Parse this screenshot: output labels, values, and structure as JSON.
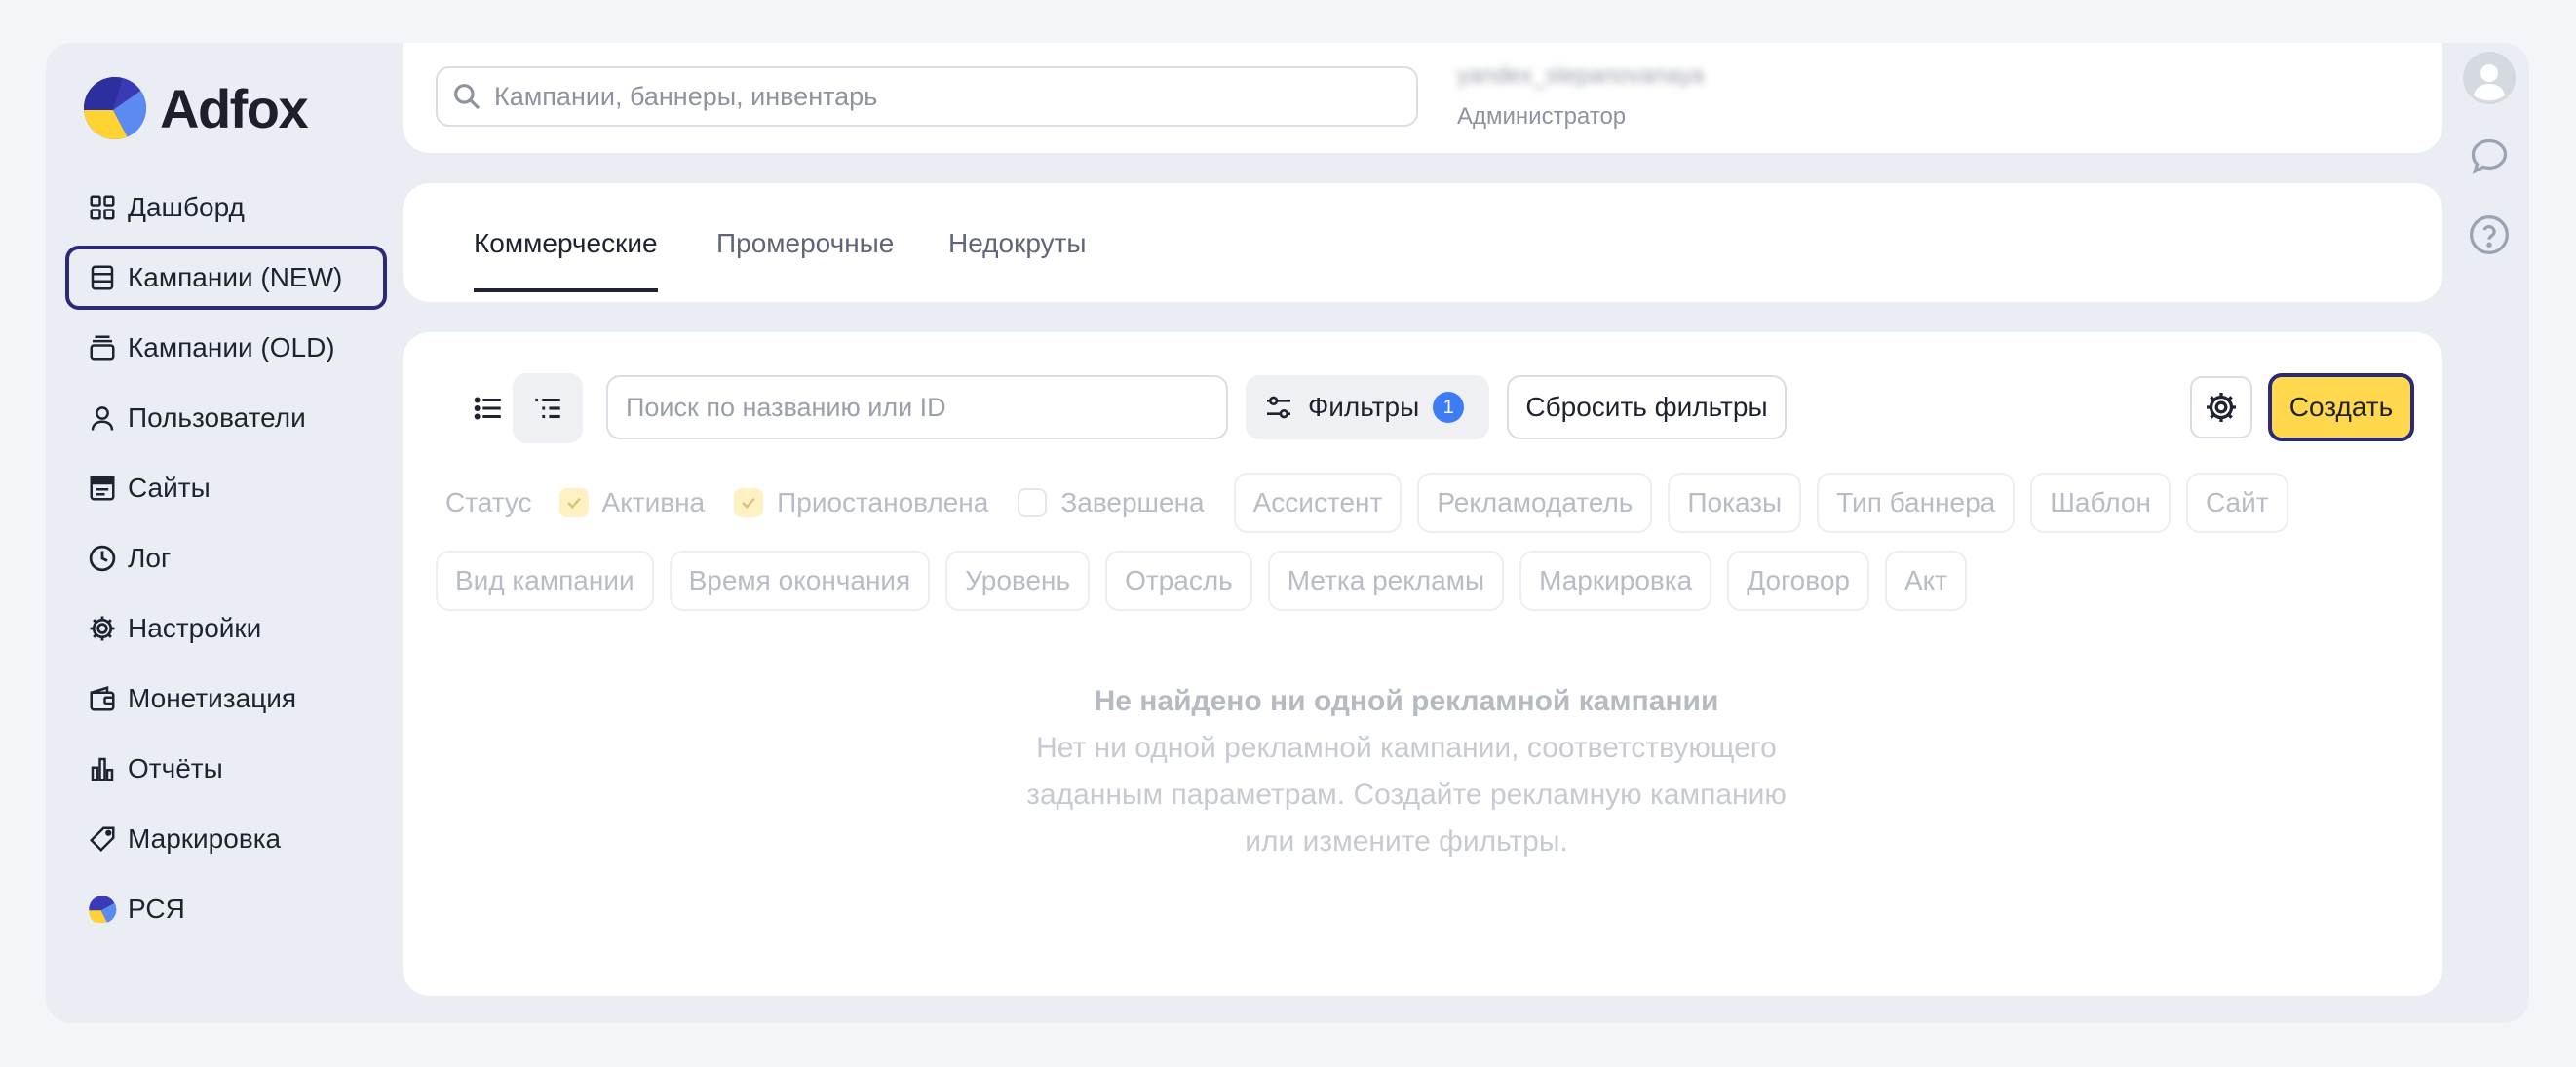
{
  "app": {
    "logo_text": "Adfox"
  },
  "sidebar": {
    "items": [
      {
        "label": "Дашборд",
        "icon": "dashboard-icon"
      },
      {
        "label": "Кампании (NEW)",
        "icon": "campaigns-new-icon",
        "active": true
      },
      {
        "label": "Кампании (OLD)",
        "icon": "campaigns-old-icon"
      },
      {
        "label": "Пользователи",
        "icon": "user-icon"
      },
      {
        "label": "Сайты",
        "icon": "sites-icon"
      },
      {
        "label": "Лог",
        "icon": "clock-icon"
      },
      {
        "label": "Настройки",
        "icon": "gear-icon"
      },
      {
        "label": "Монетизация",
        "icon": "wallet-icon"
      },
      {
        "label": "Отчёты",
        "icon": "bar-chart-icon"
      },
      {
        "label": "Маркировка",
        "icon": "tag-icon"
      },
      {
        "label": "РСЯ",
        "icon": "rsya-logo-icon"
      }
    ]
  },
  "header": {
    "search_placeholder": "Кампании, баннеры, инвентарь",
    "user_name": "yandex_stepanovanaya",
    "user_role": "Администратор"
  },
  "tabs": [
    {
      "label": "Коммерческие",
      "active": true
    },
    {
      "label": "Промерочные"
    },
    {
      "label": "Недокруты"
    }
  ],
  "toolbar": {
    "search_placeholder": "Поиск по названию или ID",
    "filters_label": "Фильтры",
    "filters_count": "1",
    "reset_label": "Сбросить фильтры",
    "create_label": "Создать"
  },
  "filters": {
    "status_label": "Статус",
    "status_options": [
      {
        "label": "Активна",
        "checked": true
      },
      {
        "label": "Приостановлена",
        "checked": true
      },
      {
        "label": "Завершена",
        "checked": false
      }
    ],
    "row1_chips": [
      "Ассистент",
      "Рекламодатель",
      "Показы",
      "Тип баннера",
      "Шаблон",
      "Сайт"
    ],
    "row2_chips": [
      "Вид кампании",
      "Время окончания",
      "Уровень",
      "Отрасль",
      "Метка рекламы",
      "Маркировка",
      "Договор",
      "Акт"
    ]
  },
  "empty_state": {
    "title": "Не найдено ни одной рекламной кампании",
    "text": "Нет ни одной рекламной кампании, соответствующего заданным параметрам. Создайте рекламную кампанию или измените фильтры."
  },
  "colors": {
    "accent_outline": "#2b2a7a",
    "create_button": "#ffd84e",
    "badge": "#3d7cf2"
  }
}
